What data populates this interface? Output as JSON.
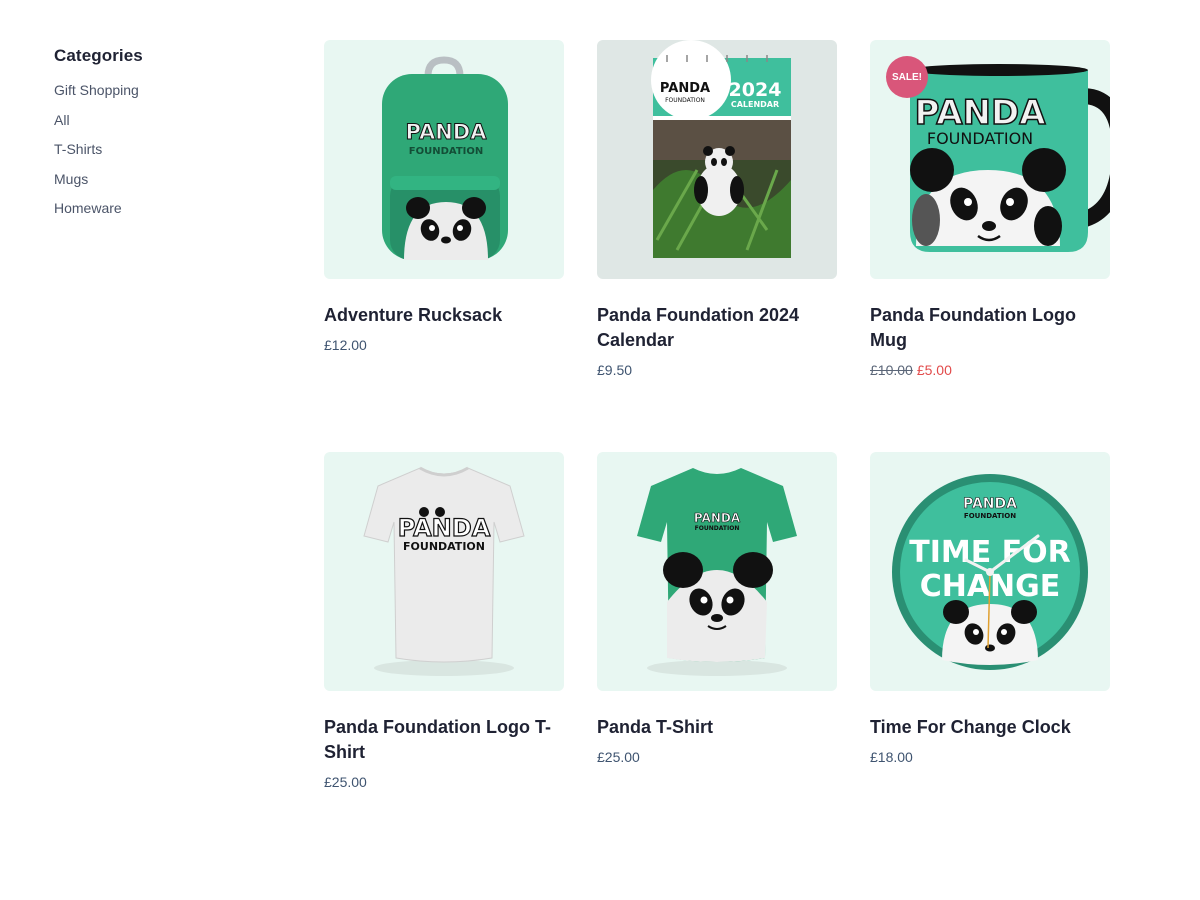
{
  "sidebar": {
    "heading": "Categories",
    "items": [
      {
        "label": "Gift Shopping"
      },
      {
        "label": "All"
      },
      {
        "label": "T-Shirts"
      },
      {
        "label": "Mugs"
      },
      {
        "label": "Homeware"
      }
    ]
  },
  "products": [
    {
      "title": "Adventure Rucksack",
      "price": "£12.00"
    },
    {
      "title": "Panda Foundation 2024 Calendar",
      "price": "£9.50"
    },
    {
      "title": "Panda Foundation Logo Mug",
      "old_price": "£10.00",
      "price": "£5.00",
      "badge": "SALE!"
    },
    {
      "title": "Panda Foundation Logo T-Shirt",
      "price": "£25.00"
    },
    {
      "title": "Panda T-Shirt",
      "price": "£25.00"
    },
    {
      "title": "Time For Change Clock",
      "price": "£18.00"
    }
  ],
  "images": {
    "brand_line1": "PANDA",
    "brand_line2": "FOUNDATION",
    "calendar_year": "2024",
    "calendar_word": "CALENDAR",
    "clock_line1": "TIME FOR",
    "clock_line2": "CHANGE"
  },
  "colors": {
    "brand_green": "#2fa877",
    "clock_teal": "#3fbf9d",
    "sale_pink": "#d9567a",
    "sale_red": "#e24b4b"
  }
}
